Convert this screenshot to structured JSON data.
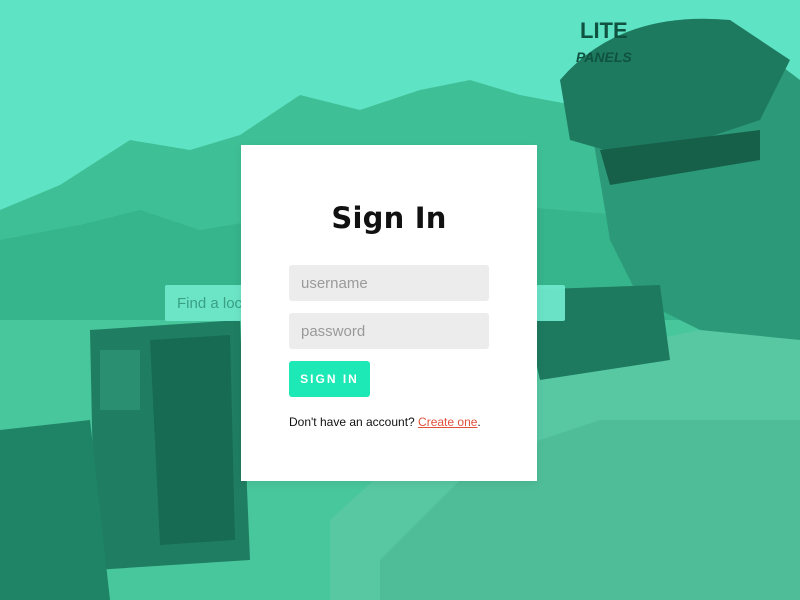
{
  "background": {
    "tint_color": "#2fb88f",
    "cap_text_line1": "LITE",
    "cap_text_line2": "PANELS"
  },
  "search": {
    "placeholder": "Find a location"
  },
  "login": {
    "title": "Sign In",
    "username_placeholder": "username",
    "username_value": "",
    "password_placeholder": "password",
    "password_value": "",
    "button_label": "SIGN IN",
    "footer_prefix": "Don't have an account? ",
    "footer_link": "Create one",
    "footer_suffix": "."
  },
  "colors": {
    "button": "#1de9b6",
    "link": "#e0513a",
    "field_bg": "#ececec"
  }
}
